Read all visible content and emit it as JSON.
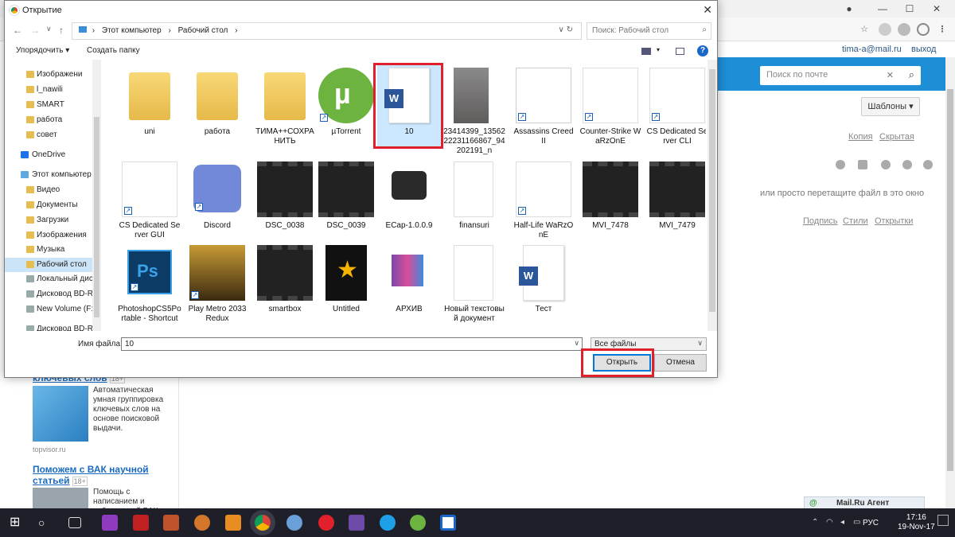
{
  "browser": {
    "user_email": "tima-a@mail.ru",
    "exit_label": "выход",
    "search_placeholder": "Поиск по почте",
    "templates_label": "Шаблоны",
    "copy_link": "Копия",
    "bcc_link": "Скрытая",
    "drop_hint": "или просто перетащите файл в это окно",
    "signature_link": "Подпись",
    "styles_link": "Стили",
    "postcards_link": "Открытки",
    "agent_label": "Mail.Ru Агент"
  },
  "ads": [
    {
      "title": "ключевых слов",
      "badge": "18+",
      "text": "Автоматическая умная группировка ключевых слов на основе поисковой выдачи.",
      "source": "topvisor.ru"
    },
    {
      "title": "Поможем с ВАК научной статьей",
      "badge": "18+",
      "text": "Помощь с написанием и публикацией ВАК и"
    }
  ],
  "dialog": {
    "title": "Открытие",
    "path": [
      "Этот компьютер",
      "Рабочий стол"
    ],
    "search_placeholder": "Поиск: Рабочий стол",
    "organize_label": "Упорядочить ▾",
    "new_folder_label": "Создать папку",
    "tree": [
      {
        "label": "Изображени",
        "type": "folder"
      },
      {
        "label": "l_nawili",
        "type": "folder"
      },
      {
        "label": "SMART",
        "type": "folder"
      },
      {
        "label": "работа",
        "type": "folder"
      },
      {
        "label": "совет",
        "type": "folder"
      },
      {
        "label": "OneDrive",
        "type": "cloud"
      },
      {
        "label": "Этот компьютер",
        "type": "pc"
      },
      {
        "label": "Видео",
        "type": "folder"
      },
      {
        "label": "Документы",
        "type": "folder"
      },
      {
        "label": "Загрузки",
        "type": "folder"
      },
      {
        "label": "Изображения",
        "type": "folder"
      },
      {
        "label": "Музыка",
        "type": "folder"
      },
      {
        "label": "Рабочий стол",
        "type": "folder",
        "selected": true
      },
      {
        "label": "Локальный дис",
        "type": "drive"
      },
      {
        "label": "Дисковод BD-RO",
        "type": "drive"
      },
      {
        "label": "New Volume (F:)",
        "type": "drive"
      },
      {
        "label": "Дисковод BD-RO",
        "type": "drive"
      }
    ],
    "files": [
      {
        "label": "uni",
        "kind": "folder"
      },
      {
        "label": "работа",
        "kind": "folder"
      },
      {
        "label": "ТИМА++СОХРАНИТЬ",
        "kind": "folder"
      },
      {
        "label": "µTorrent",
        "kind": "utorrent",
        "shortcut": true
      },
      {
        "label": "10",
        "kind": "word",
        "selected": true
      },
      {
        "label": "23414399_1356222231166867_94202191_n",
        "kind": "photo"
      },
      {
        "label": "Assassins Creed II",
        "kind": "ac",
        "shortcut": true
      },
      {
        "label": "Counter-Strike WaRzOnE",
        "kind": "doc",
        "shortcut": true
      },
      {
        "label": "CS Dedicated Server CLI",
        "kind": "doc",
        "shortcut": true
      },
      {
        "label": "CS Dedicated Server GUI",
        "kind": "doc",
        "shortcut": true
      },
      {
        "label": "Discord",
        "kind": "discord",
        "shortcut": true
      },
      {
        "label": "DSC_0038",
        "kind": "film"
      },
      {
        "label": "DSC_0039",
        "kind": "film"
      },
      {
        "label": "ECap-1.0.0.9",
        "kind": "camera"
      },
      {
        "label": "finansuri",
        "kind": "page"
      },
      {
        "label": "Half-Life WaRzOnE",
        "kind": "doc",
        "shortcut": true
      },
      {
        "label": "MVI_7478",
        "kind": "film"
      },
      {
        "label": "MVI_7479",
        "kind": "film"
      },
      {
        "label": "PhotoshopCS5Portable - Shortcut",
        "kind": "ps",
        "shortcut": true
      },
      {
        "label": "Play Metro 2033 Redux",
        "kind": "metro",
        "shortcut": true
      },
      {
        "label": "smartbox",
        "kind": "film"
      },
      {
        "label": "Untitled",
        "kind": "star"
      },
      {
        "label": "АРХИВ",
        "kind": "rar"
      },
      {
        "label": "Новый текстовый документ",
        "kind": "page"
      },
      {
        "label": "Тест",
        "kind": "word"
      }
    ],
    "filename_label": "Имя файла:",
    "filename_value": "10",
    "filetype_value": "Все файлы",
    "open_label": "Открыть",
    "cancel_label": "Отмена"
  },
  "taskbar": {
    "lang": "РУС",
    "time": "17:16",
    "date": "19-Nov-17"
  },
  "colors": {
    "mail_blue": "#1e8fd6",
    "selection": "#cce8ff",
    "highlight_red": "#e0202a",
    "taskbar": "#1f1f2a"
  }
}
